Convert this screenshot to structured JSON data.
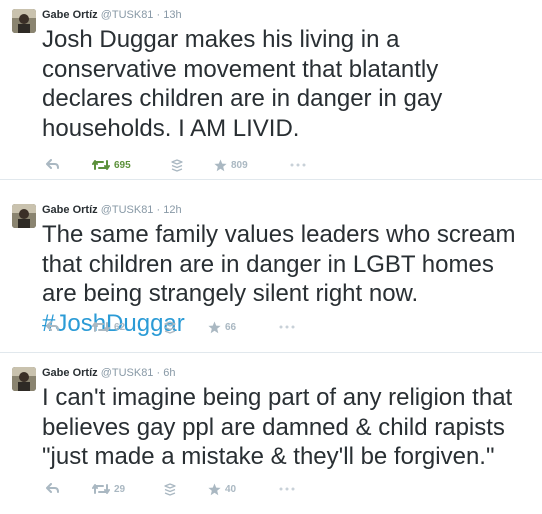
{
  "colors": {
    "text": "#292f33",
    "muted": "#8899a6",
    "action": "#aab8c2",
    "retweeted_green": "#5c913b",
    "hashtag_blue": "#2b9bd6",
    "divider": "#e1e8ed"
  },
  "tweets": [
    {
      "name": "Gabe Ortíz",
      "handle": "@TUSK81",
      "separator": "·",
      "time": "13h",
      "text": "Josh Duggar makes his living in a conservative movement that blatantly declares children are in danger in gay households. I AM LIVID.",
      "hashtag": "",
      "retweets": "695",
      "retweeted": true,
      "favorites": "809",
      "icons": [
        "reply-icon",
        "retweet-icon",
        "stack-icon",
        "favorite-star-icon",
        "more-dots-icon"
      ]
    },
    {
      "name": "Gabe Ortíz",
      "handle": "@TUSK81",
      "separator": "·",
      "time": "12h",
      "text": "The same family values leaders who scream that children are in danger in LGBT homes are being strangely silent right now. ",
      "hashtag": "#JoshDuggar",
      "retweets": "62",
      "retweeted": false,
      "favorites": "66",
      "icons": [
        "reply-icon",
        "retweet-icon",
        "stack-icon",
        "favorite-star-icon",
        "more-dots-icon"
      ]
    },
    {
      "name": "Gabe Ortíz",
      "handle": "@TUSK81",
      "separator": "·",
      "time": "6h",
      "text": "I can't imagine being part of any religion that believes gay ppl are damned & child rapists \"just made a mistake & they'll be forgiven.\"",
      "hashtag": "",
      "retweets": "29",
      "retweeted": false,
      "favorites": "40",
      "icons": [
        "reply-icon",
        "retweet-icon",
        "stack-icon",
        "favorite-star-icon",
        "more-dots-icon"
      ]
    }
  ]
}
